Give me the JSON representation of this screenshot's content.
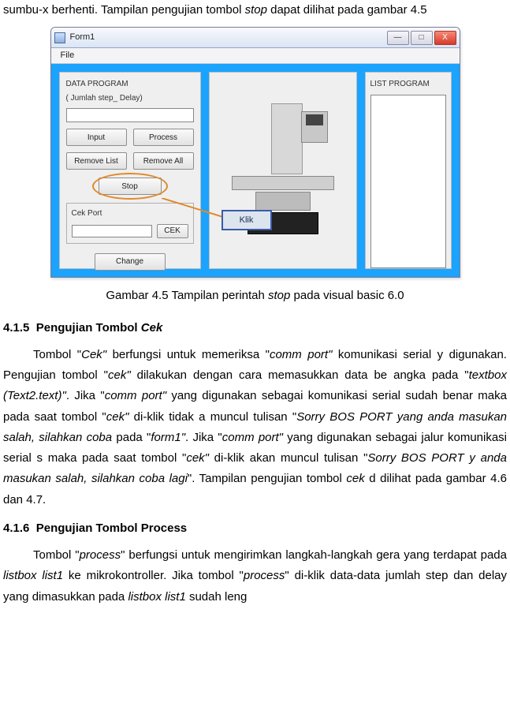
{
  "top_fragment": {
    "pre": "sumbu-x berhenti. Tampilan pengujian tombol ",
    "italic": "stop",
    "post": " dapat dilihat pada gambar 4.5"
  },
  "window": {
    "title": "Form1",
    "menu_file": "File",
    "min": "—",
    "max": "□",
    "close": "X"
  },
  "left_panel": {
    "group": "DATA PROGRAM",
    "subtitle": "( Jumlah step_ Delay)",
    "btn_input": "Input",
    "btn_process": "Process",
    "btn_remove_list": "Remove List",
    "btn_remove_all": "Remove All",
    "btn_stop": "Stop",
    "cek_label": "Cek Port",
    "btn_cek": "CEK",
    "btn_change": "Change"
  },
  "right_panel": {
    "group": "LIST PROGRAM"
  },
  "callout": {
    "label": "Klik"
  },
  "caption": {
    "pre": "Gambar 4.5 Tampilan perintah ",
    "italic": "stop",
    "post": " pada visual basic 6.0"
  },
  "sec415": {
    "num": "4.1.5",
    "title_plain": "Pengujian Tombol ",
    "title_italic": "Cek"
  },
  "para415": {
    "t1": "Tombol \"",
    "i1": "Cek\"",
    "t2": " berfungsi untuk memeriksa \"",
    "i2": "comm port\"",
    "t3": " komunikasi serial y",
    "t4": "digunakan. Pengujian tombol \"",
    "i3": "cek\"",
    "t5": " dilakukan dengan cara memasukkan data be",
    "t6": "angka pada \"",
    "i4": "textbox (Text2.text)\"",
    "t7": ". Jika \"",
    "i5": "comm port\"",
    "t8": " yang digunakan sebagai ",
    "t9": "komunikasi serial sudah benar maka pada saat tombol \"",
    "i6": "cek\"",
    "t10": " di-klik tidak a",
    "t11": "muncul tulisan \"",
    "i7": "Sorry BOS PORT yang anda masukan salah, silahkan coba ",
    "t12": "pada \"",
    "i8": "form1\"",
    "t13": ". Jika \"",
    "i9": "comm port\"",
    "t14": " yang digunakan sebagai jalur komunikasi serial s",
    "t15": "maka pada saat tombol \"",
    "i10": "cek\"",
    "t16": " di-klik akan muncul tulisan \"",
    "i11": "Sorry BOS PORT y",
    "i12": "anda masukan salah, silahkan coba lagi",
    "t17": "\". Tampilan pengujian tombol ",
    "i13": "cek",
    "t18": " d",
    "t19": "dilihat pada gambar 4.6 dan 4.7."
  },
  "sec416": {
    "num": "4.1.6",
    "title": "Pengujian Tombol Process"
  },
  "para416": {
    "t1": "Tombol \"",
    "i1": "process",
    "t2": "\" berfungsi untuk mengirimkan langkah-langkah gera",
    "t3": "yang terdapat pada ",
    "i2": "listbox list1",
    "t4": " ke mikrokontroller. Jika tombol \"",
    "i3": "process",
    "t5": "\" di-klik",
    "t6": "data-data jumlah step dan delay yang dimasukkan pada ",
    "i4": "listbox list1",
    "t7": " sudah leng"
  }
}
